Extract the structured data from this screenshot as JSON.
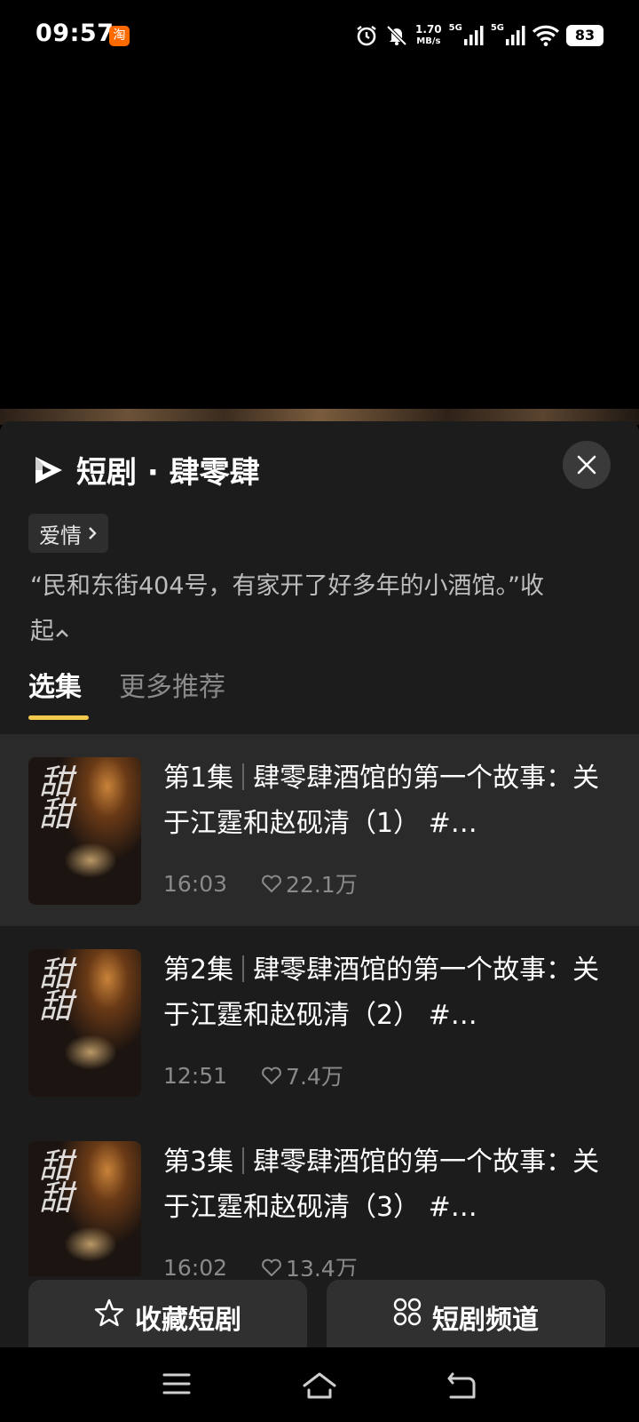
{
  "status_bar": {
    "time": "09:57",
    "app_badge": "淘",
    "speed_value": "1.70",
    "speed_unit": "MB/s",
    "network_1": "5G",
    "network_2": "5G",
    "battery": "83"
  },
  "sheet": {
    "title": "短剧 · 肆零肆",
    "tag_label": "爱情",
    "description": "“民和东街404号，有家开了好多年的小酒馆。”",
    "collapse_label": "收起",
    "tabs": [
      {
        "label": "选集",
        "active": true
      },
      {
        "label": "更多推荐",
        "active": false
      }
    ],
    "episodes": [
      {
        "number": "第1集",
        "title": "肆零肆酒馆的第一个故事：关于江霆和赵砚清（1） #…",
        "duration": "16:03",
        "likes": "22.1万"
      },
      {
        "number": "第2集",
        "title": "肆零肆酒馆的第一个故事：关于江霆和赵砚清（2） #…",
        "duration": "12:51",
        "likes": "7.4万"
      },
      {
        "number": "第3集",
        "title": "肆零肆酒馆的第一个故事：关于江霆和赵砚清（3） #…",
        "duration": "16:02",
        "likes": "13.4万"
      }
    ],
    "actions": {
      "favorite_label": "收藏短剧",
      "channel_label": "短剧频道"
    }
  },
  "colors": {
    "accent_underline": "#f2c94c",
    "sheet_bg": "#1c1c1c",
    "active_row_bg": "#2a2a2a"
  },
  "icons": [
    "alarm-icon",
    "mute-icon",
    "signal-icon",
    "wifi-icon",
    "battery-icon",
    "play-logo-icon",
    "close-icon",
    "chevron-right-icon",
    "chevron-up-icon",
    "heart-icon",
    "star-icon",
    "grid-icon",
    "menu-icon",
    "home-icon",
    "back-icon"
  ]
}
